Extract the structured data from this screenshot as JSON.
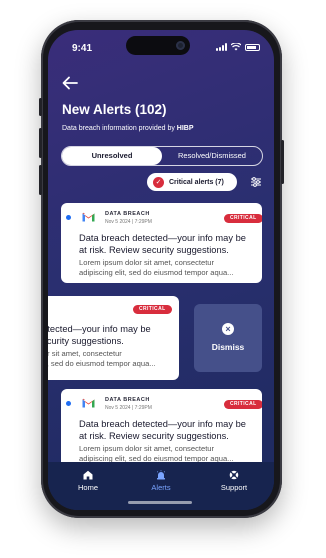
{
  "status_bar": {
    "time": "9:41"
  },
  "header": {
    "title": "New Alerts (102)",
    "subtitle_prefix": "Data breach information provided by",
    "subtitle_brand": "HIBP"
  },
  "tabs": [
    {
      "label": "Unresolved",
      "active": true
    },
    {
      "label": "Resolved/Dismissed",
      "active": false
    }
  ],
  "filter_chip": {
    "label": "Critical alerts (7)"
  },
  "alerts": [
    {
      "category": "DATA BREACH",
      "date": "Nov 5 2024 | 7:29PM",
      "badge": "CRITICAL",
      "headline_1": "Data breach detected—your info may be",
      "headline_2": "at risk. Review security suggestions.",
      "body_1": "Lorem ipsum dolor sit amet, consectetur",
      "body_2": "adipiscing elit, sed do eiusmod tempor aqua..."
    },
    {
      "category": "",
      "date": "",
      "badge": "CRITICAL",
      "headline_1": "detected—your info may be",
      "headline_2": "security suggestions.",
      "body_1": "olor sit amet, consectetur",
      "body_2": "elit, sed do eiusmod tempor aqua..."
    },
    {
      "category": "DATA BREACH",
      "date": "Nov 5 2024 | 7:29PM",
      "badge": "CRITICAL",
      "headline_1": "Data breach detected—your info may be",
      "headline_2": "at risk. Review security suggestions.",
      "body_1": "Lorem ipsum dolor sit amet, consectetur",
      "body_2": "adipiscing elit, sed do eiusmod tempor aqua..."
    }
  ],
  "swipe_action": {
    "label": "Dismiss",
    "icon": "close-icon"
  },
  "bottom_nav": [
    {
      "label": "Home",
      "icon": "home-icon",
      "active": false
    },
    {
      "label": "Alerts",
      "icon": "alert-bell-icon",
      "active": true
    },
    {
      "label": "Support",
      "icon": "lifebuoy-icon",
      "active": false
    }
  ],
  "colors": {
    "accent": "#d82d3d",
    "unread_dot": "#1e6cf2",
    "nav_active": "#7aa4ff"
  }
}
